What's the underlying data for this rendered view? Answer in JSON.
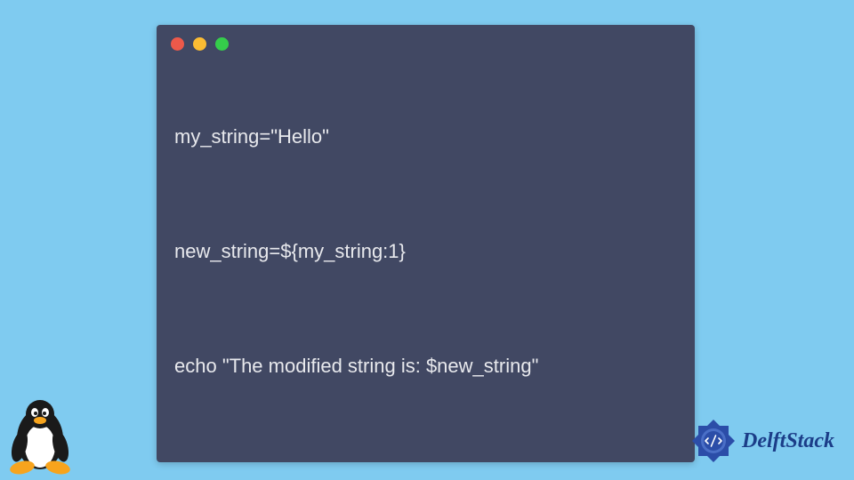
{
  "code": {
    "line1": "my_string=\"Hello\"",
    "line2": "new_string=${my_string:1}",
    "line3": "echo \"The modified string is: $new_string\""
  },
  "brand": {
    "name": "DelftStack"
  }
}
